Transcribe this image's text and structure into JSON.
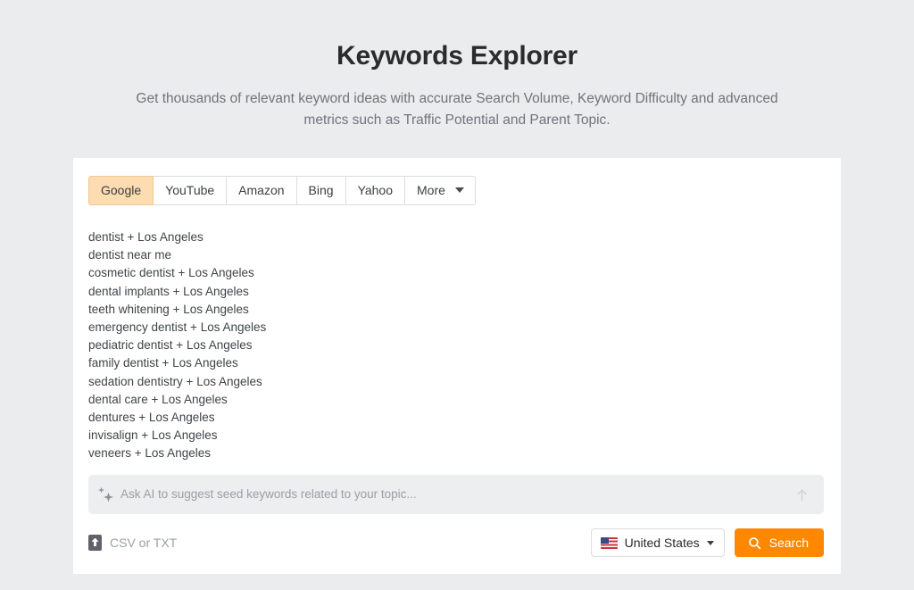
{
  "header": {
    "title": "Keywords Explorer",
    "subtitle": "Get thousands of relevant keyword ideas with accurate Search Volume, Keyword Difficulty and advanced metrics such as Traffic Potential and Parent Topic."
  },
  "tabs": [
    {
      "label": "Google",
      "active": true
    },
    {
      "label": "YouTube",
      "active": false
    },
    {
      "label": "Amazon",
      "active": false
    },
    {
      "label": "Bing",
      "active": false
    },
    {
      "label": "Yahoo",
      "active": false
    },
    {
      "label": "More",
      "active": false
    }
  ],
  "keywords": [
    "dentist + Los Angeles",
    "dentist near me",
    "cosmetic dentist + Los Angeles",
    "dental implants + Los Angeles",
    "teeth whitening + Los Angeles",
    "emergency dentist + Los Angeles",
    "pediatric dentist + Los Angeles",
    "family dentist + Los Angeles",
    "sedation dentistry + Los Angeles",
    "dental care + Los Angeles",
    "dentures + Los Angeles",
    "invisalign + Los Angeles",
    "veneers + Los Angeles"
  ],
  "ai_bar": {
    "icon": "sparkle-icon",
    "placeholder": "Ask AI to suggest seed keywords related to your topic...",
    "submit_icon": "arrow-up-icon"
  },
  "footer": {
    "upload_icon": "upload-file-icon",
    "upload_label": "CSV or TXT",
    "country": {
      "flag": "us-flag-icon",
      "label": "United States",
      "caret": "chevron-down-icon"
    },
    "search": {
      "icon": "search-icon",
      "label": "Search"
    }
  },
  "colors": {
    "page_background": "#eaecee",
    "card_background": "#ffffff",
    "accent": "#ff8800",
    "active_tab_background": "#fcdcb0",
    "active_tab_border": "#f0c78f",
    "ai_bar_background": "#eceef0",
    "muted_text": "#9aa0a6",
    "body_text": "#3f4448"
  }
}
